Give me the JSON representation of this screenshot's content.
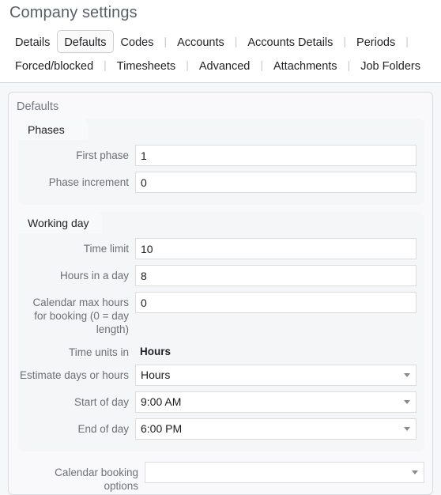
{
  "header": {
    "title": "Company settings",
    "tabs_row1": [
      {
        "label": "Details",
        "selected": false,
        "sep_after": false
      },
      {
        "label": "Defaults",
        "selected": true,
        "sep_after": false
      },
      {
        "label": "Codes",
        "selected": false,
        "sep_after": true
      },
      {
        "label": "Accounts",
        "selected": false,
        "sep_after": true
      },
      {
        "label": "Accounts Details",
        "selected": false,
        "sep_after": true
      },
      {
        "label": "Periods",
        "selected": false,
        "sep_after": true
      }
    ],
    "tabs_row2": [
      {
        "label": "Forced/blocked",
        "selected": false,
        "sep_after": true
      },
      {
        "label": "Timesheets",
        "selected": false,
        "sep_after": true
      },
      {
        "label": "Advanced",
        "selected": false,
        "sep_after": true
      },
      {
        "label": "Attachments",
        "selected": false,
        "sep_after": true
      },
      {
        "label": "Job Folders",
        "selected": false,
        "sep_after": false
      }
    ],
    "separator_glyph": "|"
  },
  "panel": {
    "legend": "Defaults",
    "groups": [
      {
        "legend": "Phases",
        "fields": [
          {
            "label": "First phase",
            "type": "text",
            "value": "1"
          },
          {
            "label": "Phase increment",
            "type": "text",
            "value": "0"
          }
        ]
      },
      {
        "legend": "Working day",
        "fields": [
          {
            "label": "Time limit",
            "type": "text",
            "value": "10"
          },
          {
            "label": "Hours in a day",
            "type": "text",
            "value": "8"
          },
          {
            "label": "Calendar max hours for booking (0 = day length)",
            "type": "text",
            "value": "0"
          },
          {
            "label": "Time units in",
            "type": "static",
            "value": "Hours"
          },
          {
            "label": "Estimate days or hours",
            "type": "select",
            "value": "Hours"
          },
          {
            "label": "Start of day",
            "type": "select",
            "value": "9:00 AM"
          },
          {
            "label": "End of day",
            "type": "select",
            "value": "6:00 PM"
          }
        ]
      }
    ],
    "loose_fields": [
      {
        "label": "Calendar booking options",
        "type": "select",
        "value": ""
      }
    ]
  },
  "icons": {
    "dropdown": "chevron-down-icon"
  },
  "colors": {
    "page_bg": "#ffffff",
    "content_bg": "#f6f7f9",
    "panel_bg": "#f9f9fb",
    "group_bg": "#f5f6f8",
    "group_legend_bg": "#f8f9fa",
    "border": "#dadbde",
    "input_border": "#dcdcdc",
    "label_text": "#6b7075",
    "title_text": "#5a6068",
    "value_text": "#1c1c1c"
  }
}
